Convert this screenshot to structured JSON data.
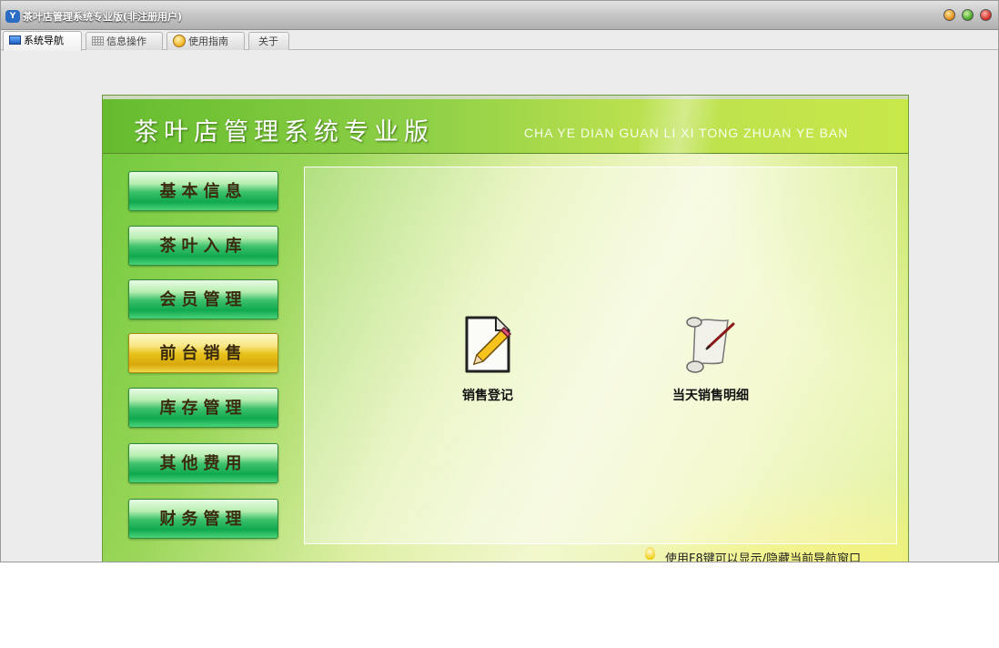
{
  "window": {
    "title": "茶叶店管理系统专业版(非注册用户)",
    "icon": "app-logo-icon"
  },
  "tabs": [
    {
      "label": "系统导航",
      "icon": "monitor-icon",
      "active": true
    },
    {
      "label": "信息操作",
      "icon": "grid-icon",
      "active": false
    },
    {
      "label": "使用指南",
      "icon": "guide-icon",
      "active": false
    },
    {
      "label": "关于",
      "icon": "",
      "active": false
    }
  ],
  "header": {
    "title": "茶叶店管理系统专业版",
    "subtitle": "CHA YE DIAN GUAN LI XI TONG ZHUAN YE BAN"
  },
  "menu": [
    {
      "label": "基本信息",
      "active": false
    },
    {
      "label": "茶叶入库",
      "active": false
    },
    {
      "label": "会员管理",
      "active": false
    },
    {
      "label": "前台销售",
      "active": true
    },
    {
      "label": "库存管理",
      "active": false
    },
    {
      "label": "其他费用",
      "active": false
    },
    {
      "label": "财务管理",
      "active": false
    }
  ],
  "functions": [
    {
      "label": "销售登记",
      "icon": "document-pencil-icon"
    },
    {
      "label": "当天销售明细",
      "icon": "scroll-icon"
    }
  ],
  "tip": {
    "text": "使用F8键可以显示/隐藏当前导航窗口",
    "icon": "lightbulb-icon"
  },
  "colors": {
    "brand_green": "#5fbf2c",
    "active_yellow": "#e8c21a",
    "button_green": "#10a84e"
  }
}
